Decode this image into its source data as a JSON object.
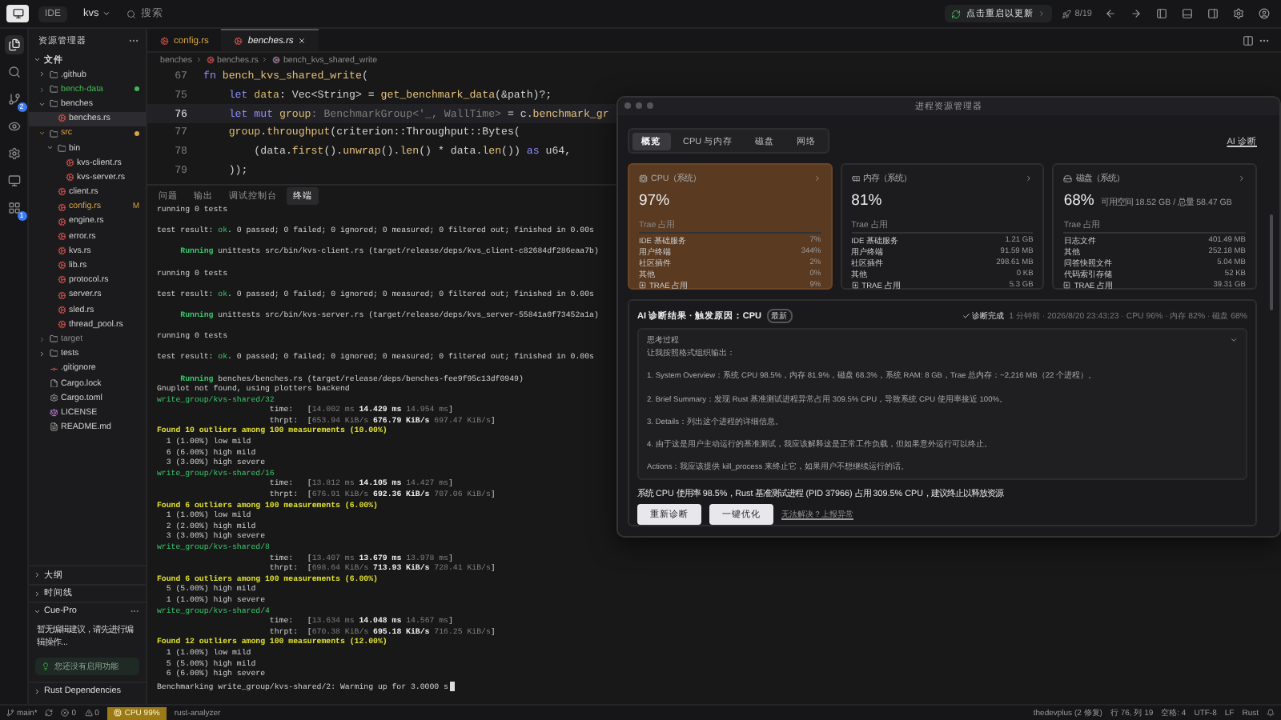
{
  "top_bar": {
    "app": "IDE",
    "project": "kvs",
    "search": {
      "placeholder": "搜索"
    },
    "update": "点击重启以更新",
    "counter": "8/19"
  },
  "activity_bar": [
    {
      "selected": true
    },
    {
      "selected": false
    },
    {
      "selected": false,
      "badge": "2"
    },
    {
      "selected": false
    },
    {
      "selected": false
    },
    {
      "selected": false
    },
    {
      "selected": false,
      "badge": "1"
    }
  ],
  "sidebar": {
    "title": "资源管理器",
    "section": "文件",
    "tree": [
      {
        "name": ".github",
        "kind": "folder",
        "expanded": false,
        "selected": false,
        "dot": false
      },
      {
        "name": "bench-data",
        "kind": "folder",
        "expanded": false,
        "selected": false,
        "dot": true,
        "color": "#3fb950"
      },
      {
        "name": "benches",
        "kind": "folder",
        "expanded": true,
        "selected": false,
        "dot": false,
        "children": [
          {
            "name": "benches.rs",
            "kind": "rust",
            "selected": true,
            "dot": false
          }
        ]
      },
      {
        "name": "src",
        "kind": "folder",
        "expanded": true,
        "selected": false,
        "dot": true,
        "color": "#d9a441",
        "children": [
          {
            "name": "bin",
            "kind": "folder",
            "expanded": true,
            "selected": false,
            "dot": false,
            "children": [
              {
                "name": "kvs-client.rs",
                "kind": "rust",
                "selected": false,
                "dot": false
              },
              {
                "name": "kvs-server.rs",
                "kind": "rust",
                "selected": false,
                "dot": false
              }
            ]
          },
          {
            "name": "client.rs",
            "kind": "rust",
            "selected": false,
            "dot": false
          },
          {
            "name": "config.rs",
            "kind": "rust",
            "selected": false,
            "dot": false,
            "color": "#d9a441",
            "status": "M"
          },
          {
            "name": "engine.rs",
            "kind": "rust",
            "selected": false,
            "dot": false
          },
          {
            "name": "error.rs",
            "kind": "rust",
            "selected": false,
            "dot": false
          },
          {
            "name": "kvs.rs",
            "kind": "rust",
            "selected": false,
            "dot": false
          },
          {
            "name": "lib.rs",
            "kind": "rust",
            "selected": false,
            "dot": false
          },
          {
            "name": "protocol.rs",
            "kind": "rust",
            "selected": false,
            "dot": false
          },
          {
            "name": "server.rs",
            "kind": "rust",
            "selected": false,
            "dot": false
          },
          {
            "name": "sled.rs",
            "kind": "rust",
            "selected": false,
            "dot": false
          },
          {
            "name": "thread_pool.rs",
            "kind": "rust",
            "selected": false,
            "dot": false
          }
        ]
      },
      {
        "name": "target",
        "kind": "folder",
        "expanded": false,
        "selected": false,
        "dot": false,
        "color": "#8a8a8a"
      },
      {
        "name": "tests",
        "kind": "folder",
        "expanded": false,
        "selected": false,
        "dot": false
      },
      {
        "name": ".gitignore",
        "kind": "git",
        "selected": false,
        "dot": false
      },
      {
        "name": "Cargo.lock",
        "kind": "file",
        "selected": false,
        "dot": false
      },
      {
        "name": "Cargo.toml",
        "kind": "toml",
        "selected": false,
        "dot": false
      },
      {
        "name": "LICENSE",
        "kind": "license",
        "selected": false,
        "dot": false
      },
      {
        "name": "README.md",
        "kind": "markdown",
        "selected": false,
        "dot": false
      }
    ],
    "panels": [
      {
        "title": "大纲",
        "expanded": false
      },
      {
        "title": "时间线",
        "expanded": false
      },
      {
        "title": "Cue-Pro",
        "expanded": true,
        "text": "暂无编辑建议，请先进行编辑操作...",
        "notice": "您还没有启用功能"
      },
      {
        "title": "Rust Dependencies",
        "expanded": false
      }
    ]
  },
  "editor": {
    "tabs": [
      {
        "label": "config.rs",
        "selected": false
      },
      {
        "label": "benches.rs",
        "selected": true
      }
    ],
    "breadcrumb": [
      "benches",
      "benches.rs",
      "bench_kvs_shared_write"
    ],
    "lines": [
      {
        "number": "67",
        "current": false,
        "parts": [
          {
            "kind": "kw",
            "text": "fn "
          },
          {
            "kind": "fn",
            "text": "bench_kvs_shared_write"
          },
          {
            "kind": "plain",
            "text": "("
          }
        ]
      },
      {
        "number": "75",
        "current": false,
        "parts": [
          {
            "kind": "kw",
            "text": "    let "
          },
          {
            "kind": "var",
            "text": "data"
          },
          {
            "kind": "plain",
            "text": ": Vec<String> = "
          },
          {
            "kind": "fn",
            "text": "get_benchmark_data"
          },
          {
            "kind": "plain",
            "text": "(&path)?;"
          }
        ]
      },
      {
        "number": "76",
        "current": true,
        "parts": [
          {
            "kind": "kw",
            "text": "    let mut "
          },
          {
            "kind": "var",
            "text": "group"
          },
          {
            "kind": "dim",
            "text": ": BenchmarkGroup<'_, WallTime>"
          },
          {
            "kind": "plain",
            "text": " = c."
          },
          {
            "kind": "fn",
            "text": "benchmark_gr"
          }
        ]
      },
      {
        "number": "77",
        "current": false,
        "parts": [
          {
            "kind": "var",
            "text": "    group"
          },
          {
            "kind": "plain",
            "text": "."
          },
          {
            "kind": "fn",
            "text": "throughput"
          },
          {
            "kind": "plain",
            "text": "(criterion::Throughput::Bytes("
          }
        ]
      },
      {
        "number": "78",
        "current": false,
        "parts": [
          {
            "kind": "plain",
            "text": "        (data."
          },
          {
            "kind": "fn",
            "text": "first"
          },
          {
            "kind": "plain",
            "text": "()."
          },
          {
            "kind": "fn",
            "text": "unwrap"
          },
          {
            "kind": "plain",
            "text": "()."
          },
          {
            "kind": "fn",
            "text": "len"
          },
          {
            "kind": "plain",
            "text": "() * data."
          },
          {
            "kind": "fn",
            "text": "len"
          },
          {
            "kind": "plain",
            "text": "()) "
          },
          {
            "kind": "kw",
            "text": "as"
          },
          {
            "kind": "plain",
            "text": " u64,"
          }
        ]
      },
      {
        "number": "79",
        "current": false,
        "parts": [
          {
            "kind": "plain",
            "text": "    ));"
          }
        ]
      }
    ]
  },
  "panel": {
    "tabs": [
      {
        "label": "问题",
        "selected": false
      },
      {
        "label": "输出",
        "selected": false
      },
      {
        "label": "调试控制台",
        "selected": false
      },
      {
        "label": "终端",
        "selected": true
      }
    ],
    "terminal": [
      {
        "kind": "text",
        "parts": [
          {
            "kind": "plain",
            "text": "running 0 tests"
          }
        ]
      },
      {
        "kind": "gap"
      },
      {
        "kind": "text",
        "parts": [
          {
            "kind": "plain",
            "text": "test result: "
          },
          {
            "kind": "green",
            "text": "ok"
          },
          {
            "kind": "plain",
            "text": ". 0 passed; 0 failed; 0 ignored; 0 measured; 0 filtered out; finished in 0.00s"
          }
        ]
      },
      {
        "kind": "gap"
      },
      {
        "kind": "text",
        "parts": [
          {
            "kind": "run",
            "text": "     Running"
          },
          {
            "kind": "plain",
            "text": " unittests src/bin/kvs-client.rs (target/release/deps/kvs_client-c82684df286eaa7b)"
          }
        ]
      },
      {
        "kind": "gap"
      },
      {
        "kind": "text",
        "parts": [
          {
            "kind": "plain",
            "text": "running 0 tests"
          }
        ]
      },
      {
        "kind": "gap"
      },
      {
        "kind": "text",
        "parts": [
          {
            "kind": "plain",
            "text": "test result: "
          },
          {
            "kind": "green",
            "text": "ok"
          },
          {
            "kind": "plain",
            "text": ". 0 passed; 0 failed; 0 ignored; 0 measured; 0 filtered out; finished in 0.00s"
          }
        ]
      },
      {
        "kind": "gap"
      },
      {
        "kind": "text",
        "parts": [
          {
            "kind": "run",
            "text": "     Running"
          },
          {
            "kind": "plain",
            "text": " unittests src/bin/kvs-server.rs (target/release/deps/kvs_server-55841a0f73452a1a)"
          }
        ]
      },
      {
        "kind": "gap"
      },
      {
        "kind": "text",
        "parts": [
          {
            "kind": "plain",
            "text": "running 0 tests"
          }
        ]
      },
      {
        "kind": "gap"
      },
      {
        "kind": "text",
        "parts": [
          {
            "kind": "plain",
            "text": "test result: "
          },
          {
            "kind": "green",
            "text": "ok"
          },
          {
            "kind": "plain",
            "text": ". 0 passed; 0 failed; 0 ignored; 0 measured; 0 filtered out; finished in 0.00s"
          }
        ]
      },
      {
        "kind": "gap"
      },
      {
        "kind": "text",
        "parts": [
          {
            "kind": "run",
            "text": "     Running"
          },
          {
            "kind": "plain",
            "text": " benches/benches.rs (target/release/deps/benches-fee9f95c13df0949)"
          }
        ]
      },
      {
        "kind": "text",
        "parts": [
          {
            "kind": "plain",
            "text": "Gnuplot not found, using plotters backend"
          }
        ]
      },
      {
        "kind": "text",
        "parts": [
          {
            "kind": "green",
            "text": "write_group/kvs-shared/32"
          }
        ]
      },
      {
        "kind": "text",
        "parts": [
          {
            "kind": "plain",
            "text": "                        time:   ["
          },
          {
            "kind": "dim",
            "text": "14.002 ms "
          },
          {
            "kind": "bold",
            "text": "14.429 ms"
          },
          {
            "kind": "dim",
            "text": " 14.954 ms"
          },
          {
            "kind": "plain",
            "text": "]"
          }
        ]
      },
      {
        "kind": "text",
        "parts": [
          {
            "kind": "plain",
            "text": "                        thrpt:  ["
          },
          {
            "kind": "dim",
            "text": "653.94 KiB/s "
          },
          {
            "kind": "bold",
            "text": "676.79 KiB/s"
          },
          {
            "kind": "dim",
            "text": " 697.47 KiB/s"
          },
          {
            "kind": "plain",
            "text": "]"
          }
        ]
      },
      {
        "kind": "text",
        "parts": [
          {
            "kind": "yellow",
            "text": "Found 10 outliers among 100 measurements (10.00%)"
          }
        ]
      },
      {
        "kind": "text",
        "parts": [
          {
            "kind": "plain",
            "text": "  1 (1.00%) low mild"
          }
        ]
      },
      {
        "kind": "text",
        "parts": [
          {
            "kind": "plain",
            "text": "  6 (6.00%) high mild"
          }
        ]
      },
      {
        "kind": "text",
        "parts": [
          {
            "kind": "plain",
            "text": "  3 (3.00%) high severe"
          }
        ]
      },
      {
        "kind": "text",
        "parts": [
          {
            "kind": "green",
            "text": "write_group/kvs-shared/16"
          }
        ]
      },
      {
        "kind": "text",
        "parts": [
          {
            "kind": "plain",
            "text": "                        time:   ["
          },
          {
            "kind": "dim",
            "text": "13.812 ms "
          },
          {
            "kind": "bold",
            "text": "14.105 ms"
          },
          {
            "kind": "dim",
            "text": " 14.427 ms"
          },
          {
            "kind": "plain",
            "text": "]"
          }
        ]
      },
      {
        "kind": "text",
        "parts": [
          {
            "kind": "plain",
            "text": "                        thrpt:  ["
          },
          {
            "kind": "dim",
            "text": "676.91 KiB/s "
          },
          {
            "kind": "bold",
            "text": "692.36 KiB/s"
          },
          {
            "kind": "dim",
            "text": " 707.06 KiB/s"
          },
          {
            "kind": "plain",
            "text": "]"
          }
        ]
      },
      {
        "kind": "text",
        "parts": [
          {
            "kind": "yellow",
            "text": "Found 6 outliers among 100 measurements (6.00%)"
          }
        ]
      },
      {
        "kind": "text",
        "parts": [
          {
            "kind": "plain",
            "text": "  1 (1.00%) low mild"
          }
        ]
      },
      {
        "kind": "text",
        "parts": [
          {
            "kind": "plain",
            "text": "  2 (2.00%) high mild"
          }
        ]
      },
      {
        "kind": "text",
        "parts": [
          {
            "kind": "plain",
            "text": "  3 (3.00%) high severe"
          }
        ]
      },
      {
        "kind": "text",
        "parts": [
          {
            "kind": "green",
            "text": "write_group/kvs-shared/8"
          }
        ]
      },
      {
        "kind": "text",
        "parts": [
          {
            "kind": "plain",
            "text": "                        time:   ["
          },
          {
            "kind": "dim",
            "text": "13.407 ms "
          },
          {
            "kind": "bold",
            "text": "13.679 ms"
          },
          {
            "kind": "dim",
            "text": " 13.978 ms"
          },
          {
            "kind": "plain",
            "text": "]"
          }
        ]
      },
      {
        "kind": "text",
        "parts": [
          {
            "kind": "plain",
            "text": "                        thrpt:  ["
          },
          {
            "kind": "dim",
            "text": "698.64 KiB/s "
          },
          {
            "kind": "bold",
            "text": "713.93 KiB/s"
          },
          {
            "kind": "dim",
            "text": " 728.41 KiB/s"
          },
          {
            "kind": "plain",
            "text": "]"
          }
        ]
      },
      {
        "kind": "text",
        "parts": [
          {
            "kind": "yellow",
            "text": "Found 6 outliers among 100 measurements (6.00%)"
          }
        ]
      },
      {
        "kind": "text",
        "parts": [
          {
            "kind": "plain",
            "text": "  5 (5.00%) high mild"
          }
        ]
      },
      {
        "kind": "text",
        "parts": [
          {
            "kind": "plain",
            "text": "  1 (1.00%) high severe"
          }
        ]
      },
      {
        "kind": "text",
        "parts": [
          {
            "kind": "green",
            "text": "write_group/kvs-shared/4"
          }
        ]
      },
      {
        "kind": "text",
        "parts": [
          {
            "kind": "plain",
            "text": "                        time:   ["
          },
          {
            "kind": "dim",
            "text": "13.634 ms "
          },
          {
            "kind": "bold",
            "text": "14.048 ms"
          },
          {
            "kind": "dim",
            "text": " 14.567 ms"
          },
          {
            "kind": "plain",
            "text": "]"
          }
        ]
      },
      {
        "kind": "text",
        "parts": [
          {
            "kind": "plain",
            "text": "                        thrpt:  ["
          },
          {
            "kind": "dim",
            "text": "670.38 KiB/s "
          },
          {
            "kind": "bold",
            "text": "695.18 KiB/s"
          },
          {
            "kind": "dim",
            "text": " 716.25 KiB/s"
          },
          {
            "kind": "plain",
            "text": "]"
          }
        ]
      },
      {
        "kind": "text",
        "parts": [
          {
            "kind": "yellow",
            "text": "Found 12 outliers among 100 measurements (12.00%)"
          }
        ]
      },
      {
        "kind": "text",
        "parts": [
          {
            "kind": "plain",
            "text": "  1 (1.00%) low mild"
          }
        ]
      },
      {
        "kind": "text",
        "parts": [
          {
            "kind": "plain",
            "text": "  5 (5.00%) high mild"
          }
        ]
      },
      {
        "kind": "text",
        "parts": [
          {
            "kind": "plain",
            "text": "  6 (6.00%) high severe"
          }
        ]
      },
      {
        "kind": "text",
        "cursor": true,
        "parts": [
          {
            "kind": "plain",
            "text": "Benchmarking write_group/kvs-shared/2: Warming up for 3.0000 s"
          }
        ]
      }
    ]
  },
  "monitor": {
    "title": "进程资源管理器",
    "tabs": [
      {
        "label": "概览",
        "selected": true
      },
      {
        "label": "CPU 与内存",
        "selected": false
      },
      {
        "label": "磁盘",
        "selected": false
      },
      {
        "label": "网络",
        "selected": false
      }
    ],
    "ai_link": "AI 诊断",
    "cards": [
      {
        "title": "CPU（系统）",
        "value": "97%",
        "selected": true,
        "section": "Trae 占用",
        "rows": [
          {
            "kind": "item",
            "label": "IDE 基础服务",
            "value": "7%"
          },
          {
            "kind": "item",
            "label": "用户终端",
            "value": "344%"
          },
          {
            "kind": "item",
            "label": "社区插件",
            "value": "2%"
          },
          {
            "kind": "item",
            "label": "其他",
            "value": "0%"
          },
          {
            "kind": "total",
            "label": "TRAE 占用",
            "value": "9%"
          }
        ]
      },
      {
        "title": "内存（系统）",
        "value": "81%",
        "selected": false,
        "section": "Trae 占用",
        "rows": [
          {
            "kind": "item",
            "label": "IDE 基础服务",
            "value": "1.21 GB"
          },
          {
            "kind": "item",
            "label": "用户终端",
            "value": "91.59 MB"
          },
          {
            "kind": "item",
            "label": "社区插件",
            "value": "298.61 MB"
          },
          {
            "kind": "item",
            "label": "其他",
            "value": "0 KB"
          },
          {
            "kind": "total",
            "label": "TRAE 占用",
            "value": "5.3 GB"
          }
        ]
      },
      {
        "title": "磁盘（系统）",
        "value": "68%",
        "note": "可用空间 18.52 GB / 总量 58.47 GB",
        "selected": false,
        "section": "Trae 占用",
        "rows": [
          {
            "kind": "item",
            "label": "日志文件",
            "value": "401.49 MB"
          },
          {
            "kind": "item",
            "label": "其他",
            "value": "252.18 MB"
          },
          {
            "kind": "item",
            "label": "问答快照文件",
            "value": "5.04 MB"
          },
          {
            "kind": "item",
            "label": "代码索引存储",
            "value": "52 KB"
          },
          {
            "kind": "total",
            "label": "TRAE 占用",
            "value": "39.31 GB"
          }
        ]
      }
    ],
    "diagnosis": {
      "title": "AI 诊断结果 · 触发原因：CPU",
      "badge": "最新",
      "status": "诊断完成",
      "meta": "1 分钟前 · 2026/8/20 23:43:23 · CPU 96% · 内存 82% · 磁盘 68%",
      "thinking": {
        "title": "思考过程",
        "expanded": true,
        "lines": [
          "让我按照格式组织输出：",
          "1. System Overview：系统 CPU 98.5%，内存 81.9%，磁盘 68.3%，系统 RAM: 8 GB，Trae 总内存：~2,216 MB（22 个进程）。",
          "2. Brief Summary：发现 Rust 基准测试进程异常占用 309.5% CPU，导致系统 CPU 使用率接近 100%。",
          "3. Details：列出这个进程的详细信息。",
          "4. 由于这是用户主动运行的基准测试，我应该解释这是正常工作负载，但如果意外运行可以终止。",
          "Actions：我应该提供 kill_process 来终止它，如果用户不想继续运行的话。"
        ]
      },
      "summary": "系统 CPU 使用率 98.5%，Rust 基准测试进程 (PID 37966) 占用 309.5% CPU，建议终止以释放资源",
      "buttons": [
        "重新诊断",
        "一键优化"
      ],
      "link": "无法解决？上报异常"
    }
  },
  "status_bar": {
    "branch": "main*",
    "errors": "0",
    "warnings": "0",
    "cpu": "CPU 99%",
    "server": "rust-analyzer",
    "right": [
      "thedevplus (2 修复)",
      "行 76, 列 19",
      "空格: 4",
      "UTF-8",
      "LF",
      "Rust"
    ]
  }
}
